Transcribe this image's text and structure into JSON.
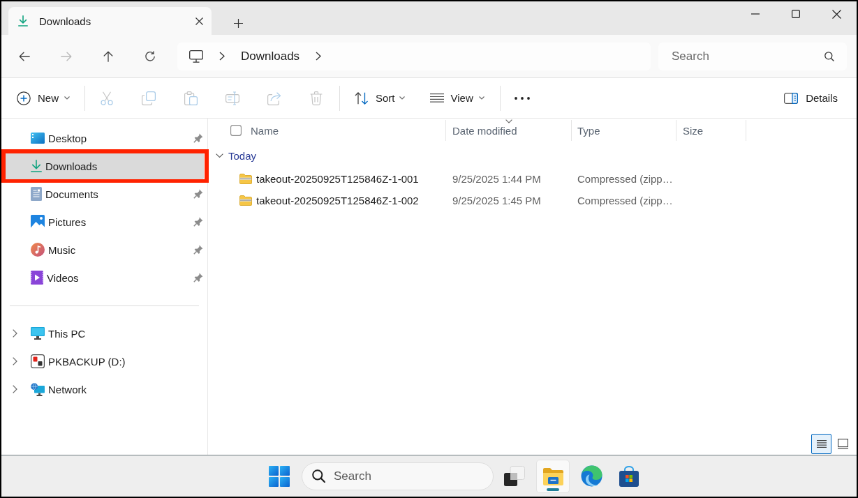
{
  "tabs": [
    {
      "label": "Downloads",
      "selected": true
    }
  ],
  "nav_buttons": [
    {
      "disabled": false
    },
    {
      "disabled": true
    },
    {
      "disabled": false
    },
    {
      "disabled": false
    }
  ],
  "address_bar": {
    "breadcrumbs": [
      "Downloads"
    ]
  },
  "search": {
    "placeholder": "Search"
  },
  "toolbar": {
    "new": {
      "label": "New"
    },
    "edit_actions": [
      {
        "disabled": true
      },
      {
        "disabled": true
      },
      {
        "disabled": true
      },
      {
        "disabled": true
      },
      {
        "disabled": true
      },
      {
        "disabled": true
      }
    ],
    "sort": {
      "label": "Sort"
    },
    "view": {
      "label": "View"
    },
    "details": {
      "label": "Details"
    }
  },
  "sidebar": {
    "quick_access": [
      {
        "label": "Desktop",
        "pinned": true,
        "selected": false,
        "highlighted": false
      },
      {
        "label": "Downloads",
        "pinned": false,
        "selected": true,
        "highlighted": true
      },
      {
        "label": "Documents",
        "pinned": true,
        "selected": false,
        "highlighted": false
      },
      {
        "label": "Pictures",
        "pinned": true,
        "selected": false,
        "highlighted": false
      },
      {
        "label": "Music",
        "pinned": true,
        "selected": false,
        "highlighted": false
      },
      {
        "label": "Videos",
        "pinned": true,
        "selected": false,
        "highlighted": false
      }
    ],
    "locations": [
      {
        "label": "This PC",
        "expanded": false,
        "selected": false
      },
      {
        "label": "PKBACKUP (D:)",
        "expanded": false,
        "selected": false
      },
      {
        "label": "Network",
        "expanded": false,
        "selected": false
      }
    ]
  },
  "file_list": {
    "select_all": {
      "checked": false
    },
    "columns": [
      {
        "label": "Name",
        "sorted": false
      },
      {
        "label": "Date modified",
        "sorted": true
      },
      {
        "label": "Type",
        "sorted": false
      },
      {
        "label": "Size",
        "sorted": false
      }
    ],
    "groups": [
      {
        "label": "Today",
        "expanded": true,
        "rows": [
          {
            "name": "takeout-20250925T125846Z-1-001",
            "date_modified": "9/25/2025 1:44 PM",
            "type": "Compressed (zipp…"
          },
          {
            "name": "takeout-20250925T125846Z-1-002",
            "date_modified": "9/25/2025 1:45 PM",
            "type": "Compressed (zipp…"
          }
        ]
      }
    ]
  },
  "view_modes": [
    {
      "selected": true
    },
    {
      "selected": false
    }
  ],
  "taskbar": {
    "search": {
      "placeholder": "Search"
    },
    "apps": [
      {
        "active": false
      },
      {
        "active": true
      },
      {
        "active": false
      },
      {
        "active": false
      }
    ]
  }
}
